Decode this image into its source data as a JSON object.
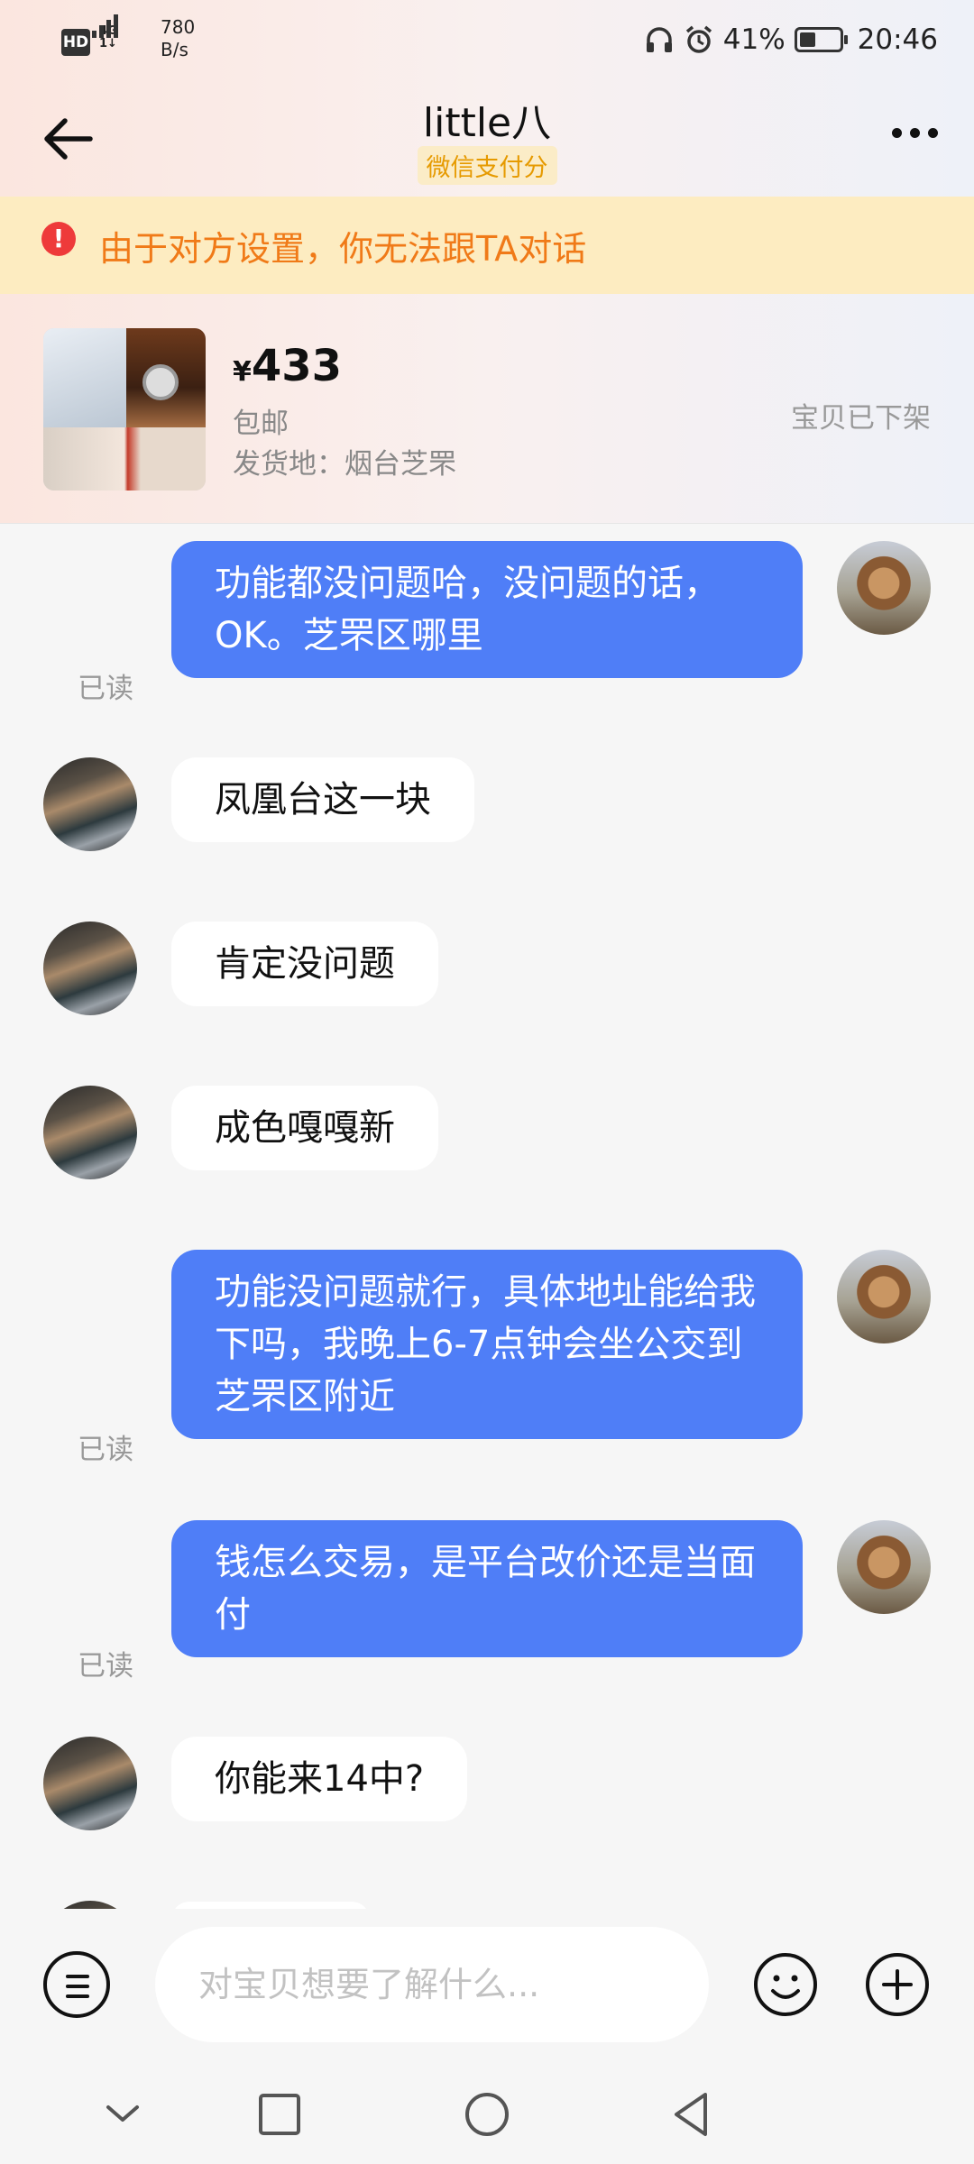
{
  "status_bar": {
    "hd": "HD",
    "network": "4G",
    "net_sub": "1↓",
    "speed_value": "780",
    "speed_unit": "B/s",
    "battery": "41%",
    "battery_level": 0.41,
    "time": "20:46"
  },
  "header": {
    "title": "little八",
    "badge": "微信支付分"
  },
  "warning": {
    "icon": "!",
    "text": "由于对方设置，你无法跟TA对话"
  },
  "product": {
    "currency": "¥",
    "price": "433",
    "shipping": "包邮",
    "origin": "发货地：烟台芝罘",
    "status": "宝贝已下架"
  },
  "messages": [
    {
      "sender": "me",
      "text": "功能都没问题哈，没问题的话，OK。芝罘区哪里",
      "read_label": "已读"
    },
    {
      "sender": "other",
      "text": "凤凰台这一块"
    },
    {
      "sender": "other",
      "text": "肯定没问题"
    },
    {
      "sender": "other",
      "text": "成色嘎嘎新"
    },
    {
      "sender": "me",
      "text": "功能没问题就行，具体地址能给我下吗，我晚上6-7点钟会坐公交到芝罘区附近",
      "read_label": "已读"
    },
    {
      "sender": "me",
      "text": "钱怎么交易，是平台改价还是当面付",
      "read_label": "已读"
    },
    {
      "sender": "other",
      "text": "你能来14中?"
    }
  ],
  "input": {
    "placeholder": "对宝贝想要了解什么..."
  },
  "icons": {
    "back": "back-arrow-icon",
    "more": "more-dots-icon",
    "menu": "menu-lines-icon",
    "emoji": "smiley-icon",
    "plus": "plus-circle-icon",
    "nav_down": "chevron-down-icon",
    "nav_recent": "square-icon",
    "nav_home": "circle-icon",
    "nav_back": "triangle-back-icon"
  },
  "colors": {
    "accent_blue": "#4f7ef7",
    "warning_bg": "#fdecc1",
    "warning_text": "#f07a18",
    "badge_text": "#e69a00"
  }
}
